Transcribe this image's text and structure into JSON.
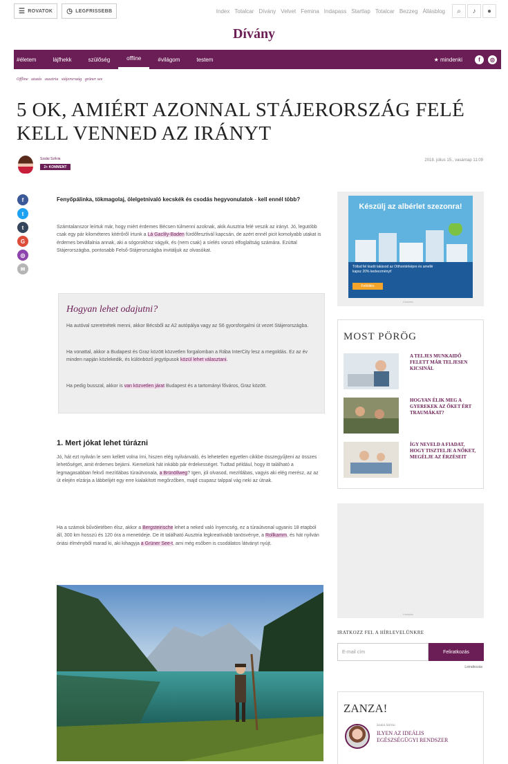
{
  "topbar": {
    "menu_label": "ROVATOK",
    "recommend_label": "LEGFRISSEBB",
    "links": [
      "Index",
      "Totalcar",
      "Dívány",
      "Velvet",
      "Femina",
      "Indapass",
      "Startlap",
      "Totalcar",
      "Bezzeg",
      "Állásblog"
    ]
  },
  "brand": "Dívány",
  "nav": {
    "items": [
      "#életem",
      "lájfhekk",
      "szülőség",
      "offline",
      "#világom",
      "testem"
    ],
    "active_index": 3,
    "right_label": "★ mindenki"
  },
  "breadcrumb": [
    "Offline",
    "utazás",
    "ausztria",
    "stájerország",
    "grüner see"
  ],
  "headline": "5 OK, AMIÉRT AZONNAL STÁJERORSZÁG FELÉ KELL VENNED AZ IRÁNYT",
  "author": {
    "name": "Szalai Szilvia",
    "badge": "2+ KOMMENT",
    "date": "2018. július 15., vasárnap 11:09"
  },
  "share_icons": [
    "facebook-icon",
    "twitter-icon",
    "tumblr-icon",
    "google-plus-icon",
    "messenger-icon",
    "email-icon"
  ],
  "article": {
    "lead": "Fenyőpálinka, tökmagolaj, ölelgetnivaló kecskék és csodás hegyvonulatok - kell ennél több?",
    "intro": [
      "Számtalanszor leírtuk már, hogy miért érdemes Bécsen túlmenni azoknak, akik Ausztria felé veszik az irányt. Jó, legutóbb csak egy pár kilométeres kitérőről írtunk a ",
      "Lá Gaclily-Baden",
      " fürdőfesztivál kapcsán, de azért ennél picit komolyabb utakat is érdemes bevállalnia annak, aki a sógorokhoz vágyik, és (nem csak) a síelés vonzó elfoglaltság számára. Ezúttal Stájerországba, pontosabb Felső-Stájerországba invitáljuk az olvasókat."
    ],
    "box": {
      "title": "Hogyan lehet odajutni?",
      "p1": "Ha autóval szeretnétek menni, akkor Bécsből az A2 autópálya vagy az S6 gyorsforgalmi út vezet Stájerországba.",
      "p2_a": "Ha vonattal, akkor a Budapest és Graz között közvetlen forgalomban a Rába InterCity lesz a megoldás. Ez az év minden napján közlekedik, és különböző jegytípusok ",
      "p2_link": "közül lehet választani",
      "p2_b": ".",
      "p3_a": "Ha pedig busszal, akkor is ",
      "p3_link": "van közvetlen járat",
      "p3_b": " Budapest és a tartományi főváros, Graz között."
    },
    "section1_title": "1. Mert jókat lehet túrázni",
    "s1p1_a": "Jó, hát ezt nyilván le sem kellett volna írni, hiszen elég nyilvánvaló, és lehetetlen egyetlen cikkbe összegyűjteni az összes lehetőséget, amit érdemes bejárni. Kiemelünk hát inkább pár érdekességet. Tudtad például, hogy itt található a legmagasabban fekvő mezítlábas túraútvonala, ",
    "s1p1_link": "a Brünöllweg",
    "s1p1_b": "? Igen, jól olvasod, mezítlábas, vagyis aki elég merész, az az út elején elzárja a lábbelijét egy erre kialakított megőrzőben, majd csupasz talppal vág neki az útnak.",
    "s1p2_a": "Ha a számok bűvöletében élsz, akkor a ",
    "s1p2_link1": "Bergsteirische",
    "s1p2_b": " lehet a neked való ínyencség, ez a túraútvonal ugyanis 18 etapból áll, 300 km hosszú és 120 óra a menetideje. De itt található Ausztria legkreatívabb tanösvénye, a ",
    "s1p2_link2": "Rollkamm",
    "s1p2_c": ", és hát nyilván óriási élményből marad ki, aki kihagyja ",
    "s1p2_link3": "a Grüner See-t",
    "s1p2_d": ", ami még esőben is csodálatos látványt nyújt."
  },
  "sidebar": {
    "ad1": {
      "title": "Készülj az albérlet szezonra!",
      "text": "Töltsd fel kiadó lakásod az Otthontérképre és amellé kapsz 20% kedvezményt!",
      "button": "Feltöltés",
      "label": "Hirdetés"
    },
    "most_porog": {
      "title": "MOST PÖRÖG",
      "items": [
        "A teljes munkaidő felett már teljesen kicsinál",
        "Hogyan élik meg a gyerekek az őket ért traumákat?",
        "Így neveld a fiadat, hogy tisztelje a nőket, megélje az érzéseit"
      ]
    },
    "ad2_label": "Hirdetés",
    "newsletter": {
      "title": "IRATKOZZ FEL A HÍRLEVELÜNKRE",
      "placeholder": "E-mail cím",
      "button": "Feliratkozás",
      "unsubscribe": "Leiratkozás"
    },
    "zanza": {
      "title": "ZANZA!",
      "author": "Szalai Szilvia",
      "text": "Ilyen az ideális egészségügyi rendszer"
    }
  },
  "colors": {
    "brand": "#6b1d55",
    "facebook": "#3b5998",
    "twitter": "#1da1f2",
    "tumblr": "#35465c",
    "google": "#dd4b39",
    "messenger": "#8e44ad",
    "email": "#b5b5b5"
  }
}
